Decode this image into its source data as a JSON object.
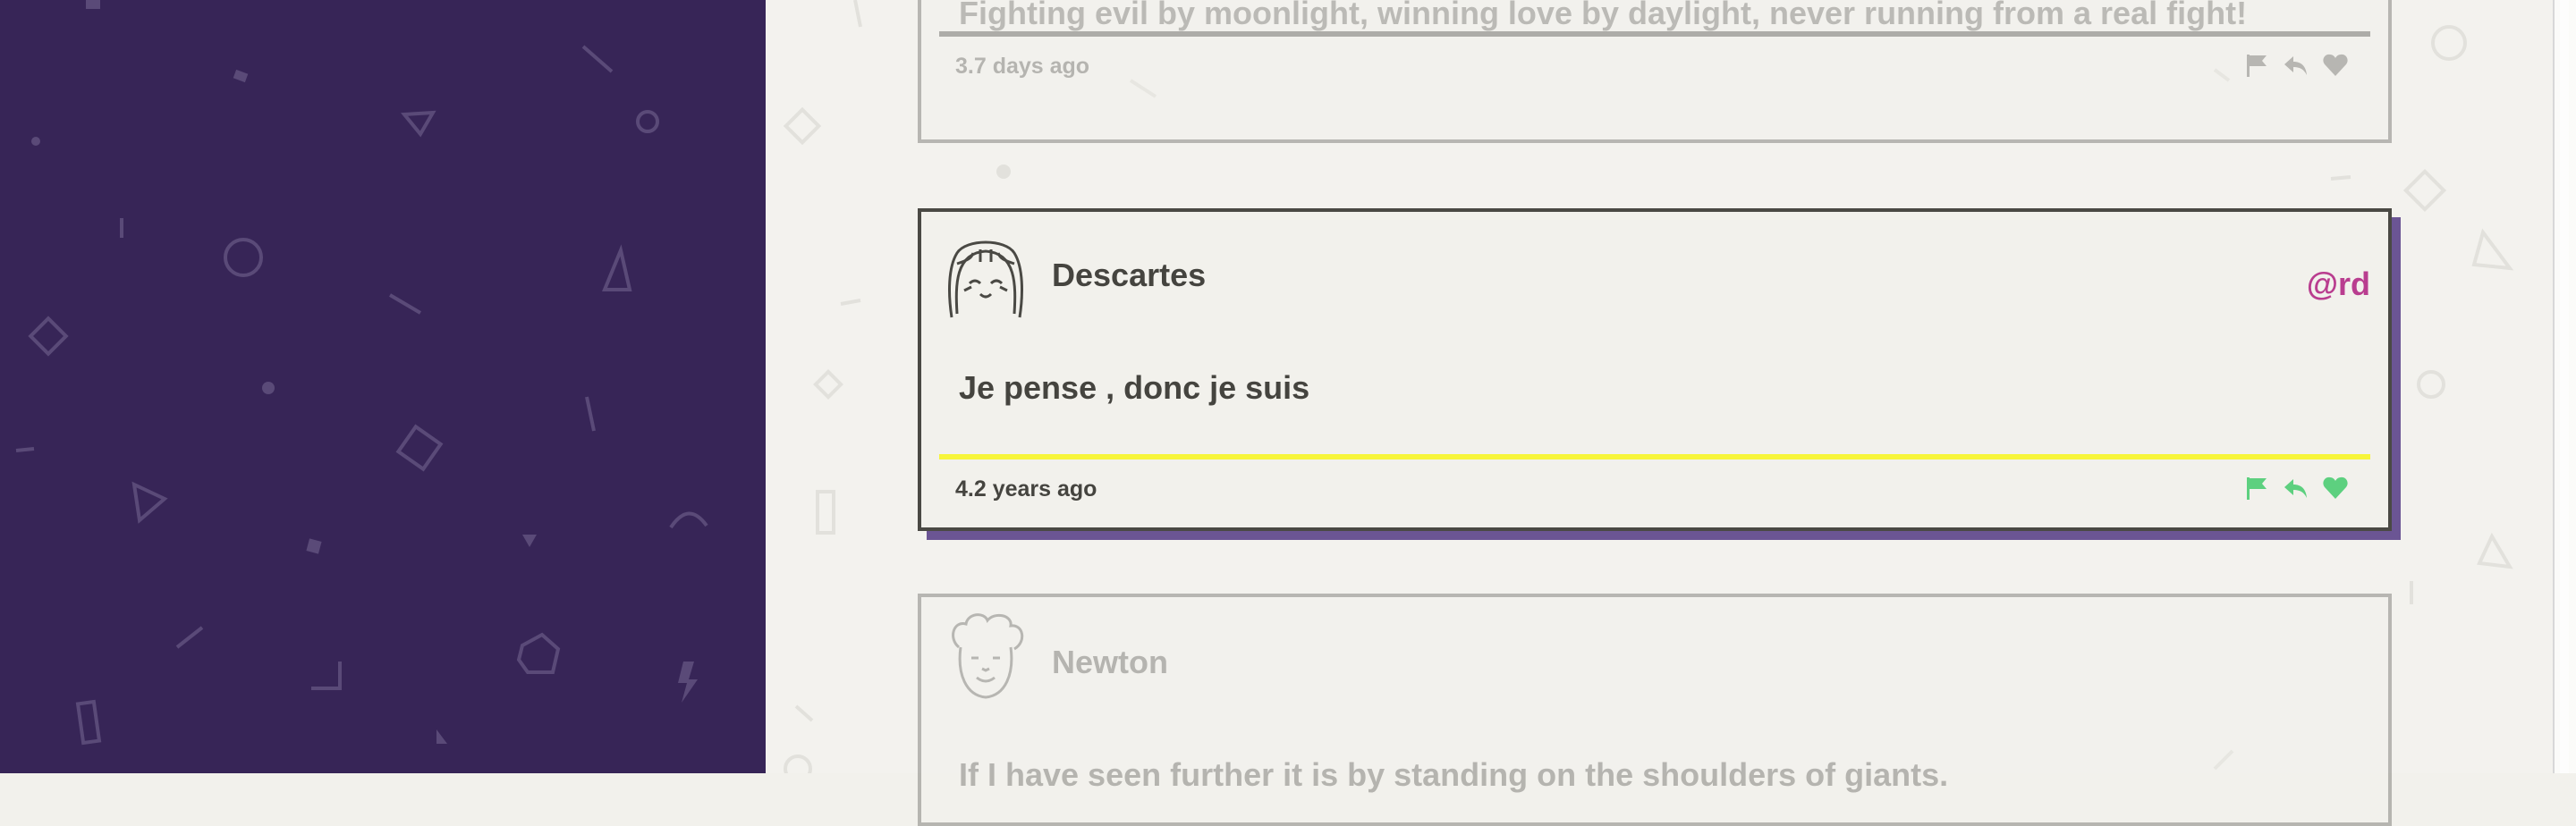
{
  "colors": {
    "sidebar_bg": "#372557",
    "main_bg": "#f3f2ee",
    "card_border": "#4a4944",
    "card_shadow": "#6b5594",
    "handle": "#b93d8f",
    "action_active": "#5dd07f",
    "divider_active": "#f7f53a"
  },
  "comments": [
    {
      "text": "Fighting evil by moonlight, winning love by daylight, never running from a real fight!",
      "time": "3.7 days ago",
      "actions": [
        "flag-icon",
        "reply-icon",
        "heart-icon"
      ]
    },
    {
      "author": "Descartes",
      "handle": "@rd",
      "text": "Je pense , donc je suis",
      "time": "4.2 years ago",
      "actions": [
        "flag-icon",
        "reply-icon",
        "heart-icon"
      ]
    },
    {
      "author": "Newton",
      "text": "If I have seen further it is by standing on the shoulders of giants."
    }
  ]
}
